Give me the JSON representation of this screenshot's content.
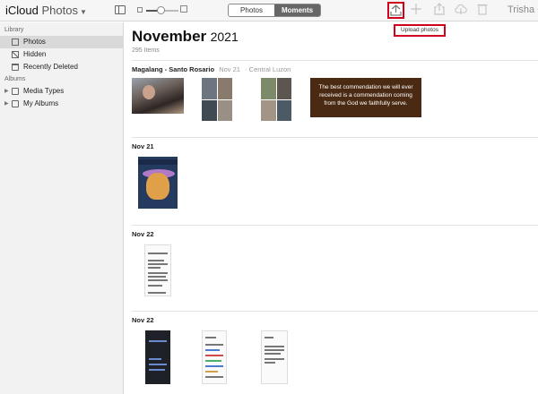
{
  "app": {
    "brand_primary": "iCloud",
    "brand_secondary": "Photos",
    "user_name": "Trisha"
  },
  "toolbar": {
    "view_tabs": [
      {
        "label": "Photos",
        "active": false
      },
      {
        "label": "Moments",
        "active": true
      }
    ],
    "zoom_level": 0.45,
    "upload_tooltip": "Upload photos",
    "accent_color": "#d0021b",
    "icons": [
      "sidebar-toggle-icon",
      "upload-icon",
      "plus-icon",
      "share-icon",
      "download-icon",
      "trash-icon"
    ]
  },
  "sidebar": {
    "library_label": "Library",
    "library_items": [
      {
        "label": "Photos",
        "icon": "photos-icon",
        "selected": true
      },
      {
        "label": "Hidden",
        "icon": "hidden-icon",
        "selected": false
      },
      {
        "label": "Recently Deleted",
        "icon": "trash-icon",
        "selected": false
      }
    ],
    "albums_label": "Albums",
    "album_items": [
      {
        "label": "Media Types",
        "icon": "folder-icon"
      },
      {
        "label": "My Albums",
        "icon": "folder-icon"
      }
    ]
  },
  "main": {
    "month": "November",
    "year": "2021",
    "item_count": "295 Items",
    "moments": [
      {
        "title": "Magalang - Santo Rosario",
        "date": "Nov 21",
        "location": "Central Luzon",
        "quote_text": "The best commendation we will ever received is a commendation coming from the God we faithfully serve."
      },
      {
        "title": "Nov 21"
      },
      {
        "title": "Nov 22"
      },
      {
        "title": "Nov 22"
      }
    ]
  }
}
